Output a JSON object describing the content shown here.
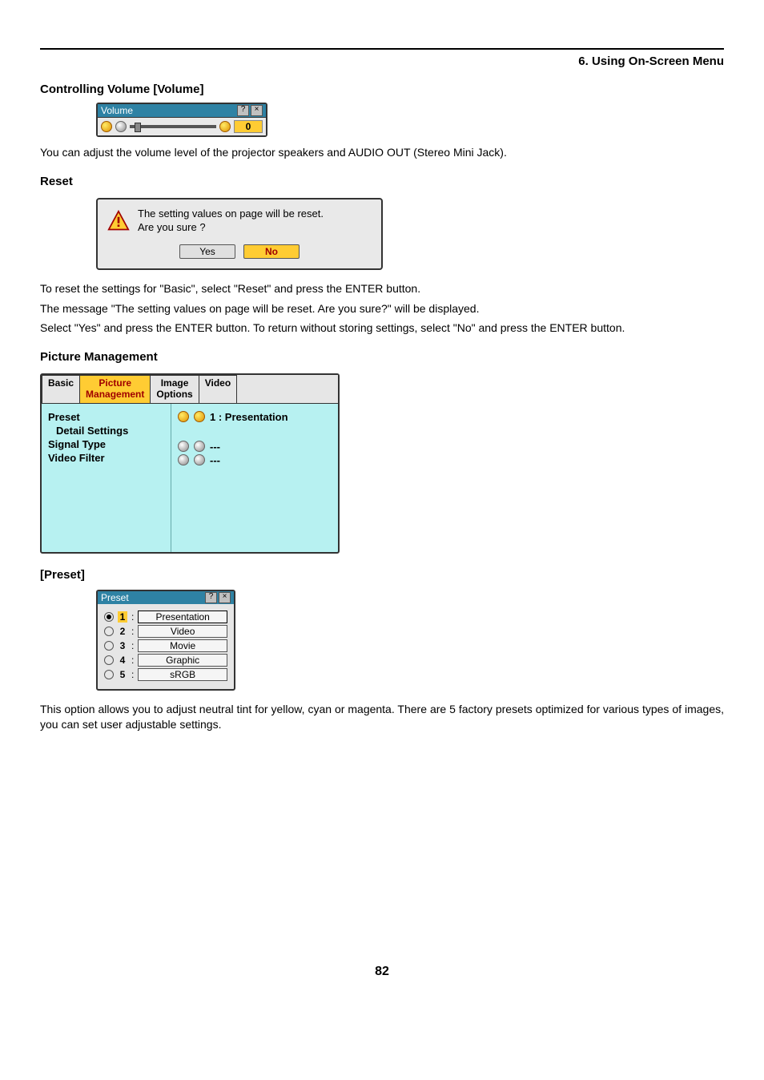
{
  "chapter": "6. Using On-Screen Menu",
  "page_number": "82",
  "volume_section": {
    "heading": "Controlling Volume [Volume]",
    "widget": {
      "title": "Volume",
      "value": "0"
    },
    "text": "You can adjust the volume level of the projector speakers and AUDIO OUT (Stereo Mini Jack)."
  },
  "reset_section": {
    "heading": "Reset",
    "dialog": {
      "line1": "The setting values on page will be reset.",
      "line2": "Are you sure ?",
      "yes": "Yes",
      "no": "No"
    },
    "para1": "To reset the settings for \"Basic\", select \"Reset\" and press the ENTER button.",
    "para2": "The message \"The setting values on page will be reset. Are you sure?\" will be displayed.",
    "para3": "Select \"Yes\" and press the ENTER button. To return without storing settings, select \"No\" and press the ENTER button."
  },
  "pm_section": {
    "heading": "Picture Management",
    "tabs": {
      "basic": "Basic",
      "pm1": "Picture",
      "pm2": "Management",
      "io1": "Image",
      "io2": "Options",
      "video": "Video"
    },
    "left": {
      "preset": "Preset",
      "detail": "Detail Settings",
      "signal": "Signal Type",
      "filter": "Video Filter"
    },
    "right": {
      "preset_val": "1 : Presentation",
      "blank": "---"
    }
  },
  "preset_section": {
    "heading": "[Preset]",
    "dialog_title": "Preset",
    "options": [
      {
        "n": "1",
        "label": "Presentation",
        "selected": true
      },
      {
        "n": "2",
        "label": "Video",
        "selected": false
      },
      {
        "n": "3",
        "label": "Movie",
        "selected": false
      },
      {
        "n": "4",
        "label": "Graphic",
        "selected": false
      },
      {
        "n": "5",
        "label": "sRGB",
        "selected": false
      }
    ],
    "text": "This option allows you to adjust neutral tint for yellow, cyan or magenta. There are 5 factory presets optimized for various types of images, you can set user adjustable settings."
  }
}
